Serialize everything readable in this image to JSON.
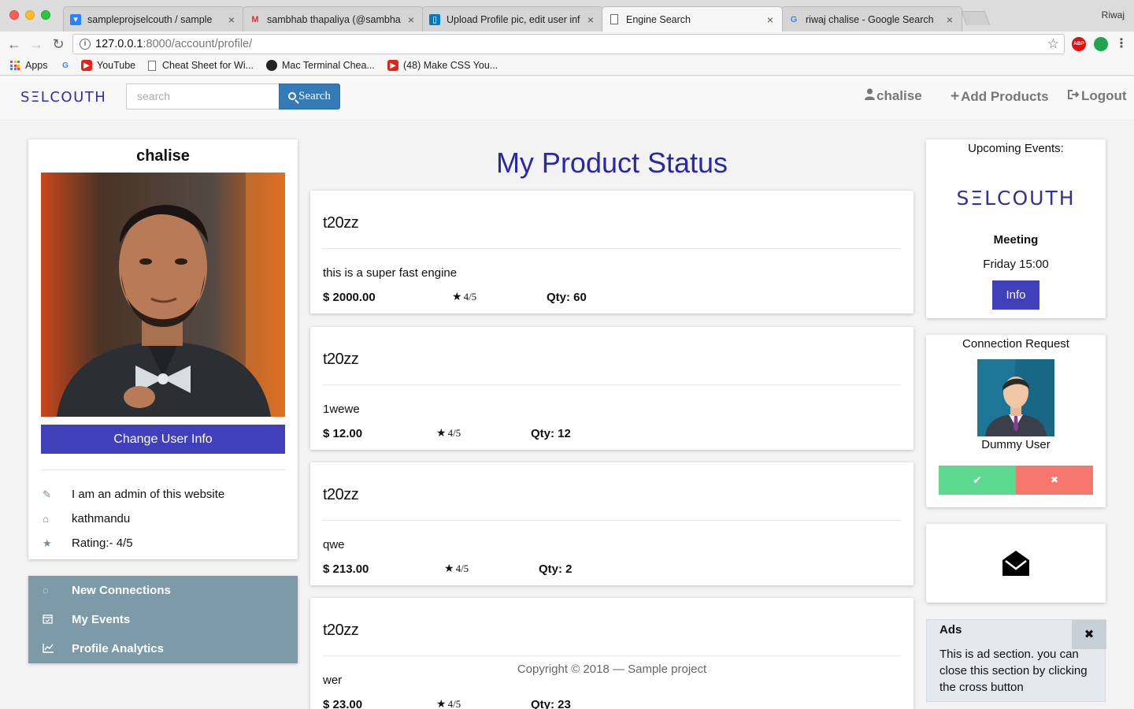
{
  "browser": {
    "tabs": [
      {
        "label": "sampleprojselcouth / sample",
        "icon": "bitbucket-icon",
        "active": false
      },
      {
        "label": "sambhab thapaliya (@sambhab",
        "icon": "gmail-icon",
        "active": false
      },
      {
        "label": "Upload Profile pic, edit user inf",
        "icon": "trello-icon",
        "active": false
      },
      {
        "label": "Engine Search",
        "icon": "page-icon",
        "active": true
      },
      {
        "label": "riwaj chalise - Google Search",
        "icon": "google-icon",
        "active": false
      }
    ],
    "profile": "Riwaj",
    "url_host": "127.0.0.1",
    "url_path": ":8000/account/profile/",
    "bookmarks": [
      {
        "label": "Apps",
        "icon": "apps-grid-icon"
      },
      {
        "label": "",
        "icon": "google-icon"
      },
      {
        "label": "YouTube",
        "icon": "youtube-icon"
      },
      {
        "label": "Cheat Sheet for Wi...",
        "icon": "page-icon"
      },
      {
        "label": "Mac Terminal Chea...",
        "icon": "github-icon"
      },
      {
        "label": "(48) Make CSS You...",
        "icon": "youtube-icon"
      }
    ],
    "ext_abp": "ABP"
  },
  "site": {
    "brand": "SΞLCOUTH",
    "search_placeholder": "search",
    "search_button": "Search",
    "nav": {
      "user": "chalise",
      "add_products": "Add Products",
      "logout": "Logout"
    }
  },
  "profile": {
    "name": "chalise",
    "change_button": "Change User Info",
    "bio": "I am an admin of this website",
    "location": "kathmandu",
    "rating": "Rating:- 4/5"
  },
  "side_menu": [
    {
      "label": "New Connections",
      "icon": "refresh-icon"
    },
    {
      "label": "My Events",
      "icon": "calendar-icon"
    },
    {
      "label": "Profile Analytics",
      "icon": "chart-icon"
    }
  ],
  "main": {
    "title": "My Product Status",
    "products": [
      {
        "name": "t20zz",
        "description": "this is a super fast engine",
        "price": "$ 2000.00",
        "rating": "4/5",
        "qty": "Qty: 60"
      },
      {
        "name": "t20zz",
        "description": "1wewe",
        "price": "$ 12.00",
        "rating": "4/5",
        "qty": "Qty: 12"
      },
      {
        "name": "t20zz",
        "description": "qwe",
        "price": "$ 213.00",
        "rating": "4/5",
        "qty": "Qty: 2"
      },
      {
        "name": "t20zz",
        "description": "wer",
        "price": "$ 23.00",
        "rating": "4/5",
        "qty": "Qty: 23"
      }
    ],
    "footer": "Copyright © 2018 — Sample project"
  },
  "events": {
    "title": "Upcoming Events:",
    "brand": "SΞLCOUTH",
    "name": "Meeting",
    "time": "Friday 15:00",
    "button": "Info"
  },
  "connection": {
    "title": "Connection Request",
    "name": "Dummy User",
    "accept": "✔",
    "reject": "✖"
  },
  "ads": {
    "title": "Ads",
    "close": "✖",
    "text": "This is ad section. you can close this section by clicking the cross button"
  },
  "colors": {
    "brand": "#2f2fa8",
    "primary_button": "#4040bb",
    "accept": "#5dd88f",
    "reject": "#f6756c",
    "side_menu": "#7c9aa8"
  }
}
